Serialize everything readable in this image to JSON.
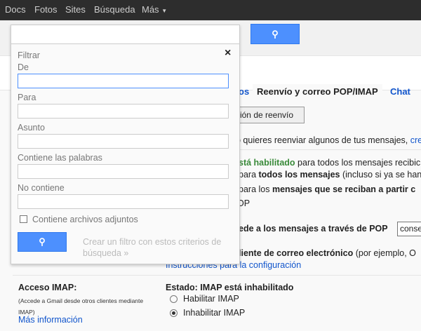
{
  "topnav": [
    "Docs",
    "Fotos",
    "Sites",
    "Búsqueda",
    "Más"
  ],
  "tabs": {
    "partial_left": "os",
    "active": "Reenvío y correo POP/IMAP",
    "chat": "Chat"
  },
  "forwarding": {
    "button": "ción de reenvío",
    "text_a": "o quieres reenviar algunos de tus mensajes, ",
    "link_a": "cre"
  },
  "pop": {
    "enabled_green": "stá habilitado",
    "enabled_rest": " para todos los mensajes recibic",
    "opt1_pre": "para ",
    "opt1_b": "todos los mensajes",
    "opt1_post": " (incluso si ya se han",
    "opt2_pre": "para los ",
    "opt2_b": "mensajes que se reciban a partir c",
    "opt3": "OP",
    "access_b": "ede a los mensajes a través de POP",
    "access_select": "conse",
    "client_b": "liente de correo electrónico",
    "client_rest": " (por ejemplo, O",
    "instructions": "Instrucciones para la configuración"
  },
  "imap": {
    "label": "Acceso IMAP:",
    "desc": "(Accede a Gmail desde otros clientes mediante IMAP)",
    "more": "Más información",
    "status": "Estado: IMAP está inhabilitado",
    "enable": "Habilitar IMAP",
    "disable": "Inhabilitar IMAP",
    "selected": "disable"
  },
  "filter": {
    "title": "Filtrar",
    "close": "×",
    "from": "De",
    "to": "Para",
    "subject": "Asunto",
    "has_words": "Contiene las palabras",
    "not_has": "No contiene",
    "attachments": "Contiene archivos adjuntos",
    "create": "Crear un filtro con estos criterios de búsqueda »"
  },
  "colors": {
    "accent": "#4d90fe",
    "topbar": "#2d2d2d",
    "link": "#1155cc",
    "green": "#398a39"
  }
}
